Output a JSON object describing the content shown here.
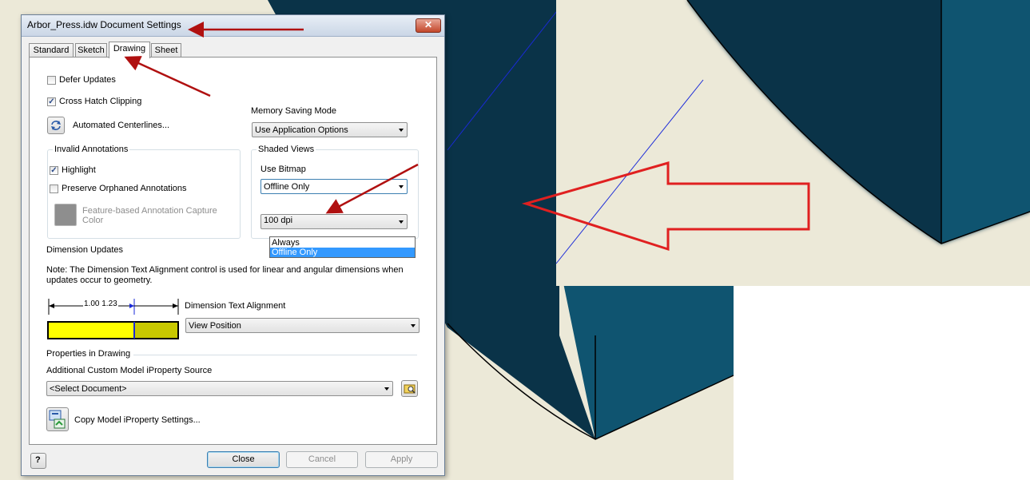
{
  "dialog": {
    "title": "Arbor_Press.idw Document Settings",
    "tabs": [
      {
        "label": "Standard",
        "active": false
      },
      {
        "label": "Sketch",
        "active": false
      },
      {
        "label": "Drawing",
        "active": true
      },
      {
        "label": "Sheet",
        "active": false
      }
    ]
  },
  "drawing": {
    "defer_updates": {
      "label": "Defer Updates",
      "checked": false
    },
    "cross_hatch_clipping": {
      "label": "Cross Hatch Clipping",
      "checked": true
    },
    "automated_centerlines_label": "Automated Centerlines...",
    "memory_saving_mode": {
      "label": "Memory Saving Mode",
      "value": "Use Application Options"
    },
    "invalid_annotations": {
      "title": "Invalid Annotations",
      "highlight": {
        "label": "Highlight",
        "checked": true
      },
      "preserve_orphaned": {
        "label": "Preserve Orphaned Annotations",
        "checked": false
      },
      "capture_color_label": "Feature-based Annotation Capture Color"
    },
    "shaded_views": {
      "title": "Shaded Views",
      "use_bitmap_label": "Use Bitmap",
      "use_bitmap_value": "Offline Only",
      "options": [
        "Always",
        "Offline Only"
      ],
      "selected_option": "Offline Only",
      "resolution_value": "100 dpi"
    },
    "dimension_updates": {
      "title": "Dimension Updates",
      "note": "Note: The Dimension Text Alignment control is used for linear and angular dimensions when updates occur to geometry.",
      "preview_text": "1.00 1.23",
      "alignment_label": "Dimension Text Alignment",
      "alignment_value": "View Position"
    },
    "properties": {
      "title": "Properties in Drawing",
      "source_label": "Additional Custom Model iProperty Source",
      "source_value": "<Select Document>",
      "copy_settings_label": "Copy Model iProperty Settings..."
    }
  },
  "footer": {
    "close_label": "Close",
    "cancel_label": "Cancel",
    "apply_label": "Apply",
    "help_icon": "?"
  },
  "colors": {
    "cad_background": "#ece9d8",
    "solid_dark": "#0a3348",
    "solid_side": "#0f5470",
    "annotation_arrow": "#e02020",
    "pointer_arrow": "#b01010",
    "preview_yellow": "#ffff00",
    "preview_olive": "#c8c800"
  }
}
